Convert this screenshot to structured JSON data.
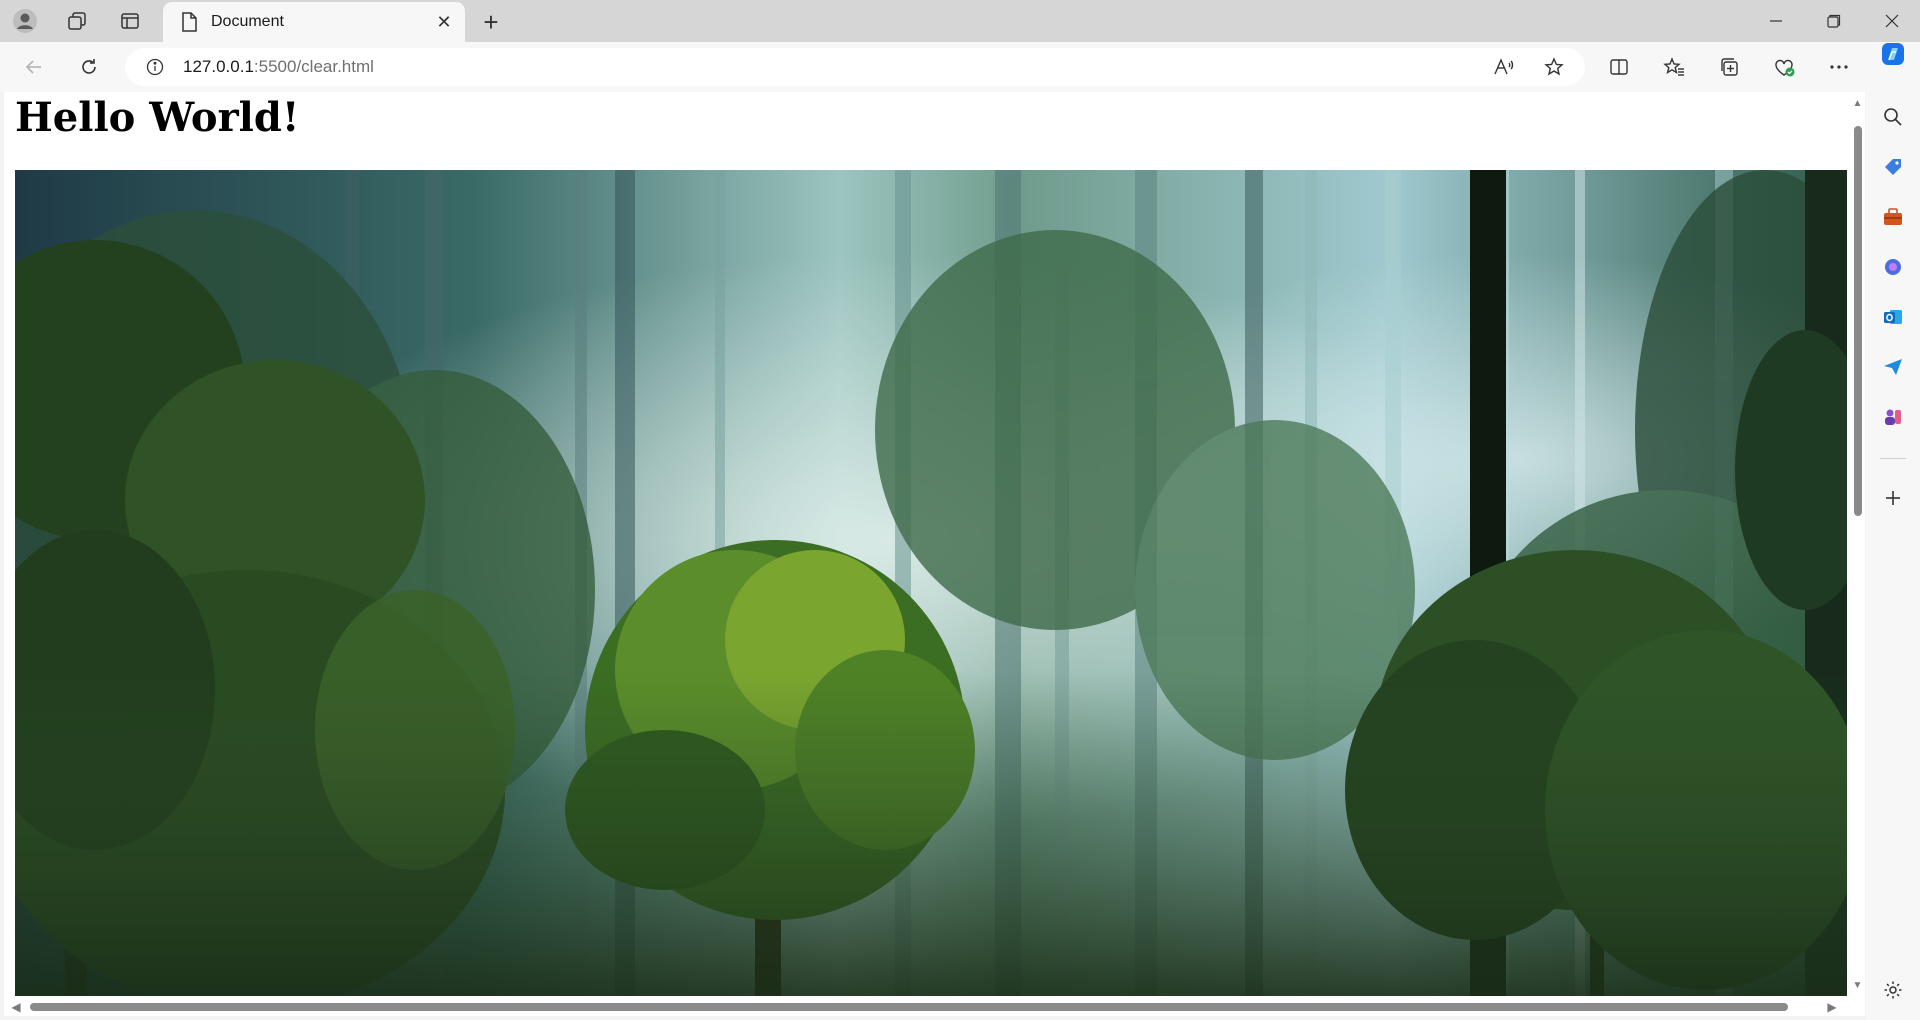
{
  "browser": {
    "tab": {
      "title": "Document"
    },
    "address": {
      "host": "127.0.0.1",
      "rest": ":5500/clear.html"
    }
  },
  "page": {
    "heading": "Hello World!",
    "image": {
      "subject": "forest",
      "colors": {
        "sky": "#bcd9d6",
        "mist": "#8fb9b4",
        "foliage": "#2f5a2a",
        "dark": "#0e1e14",
        "bright": "#6e9a2e"
      }
    }
  },
  "sidebar": {
    "icons": [
      "search-icon",
      "tag-icon",
      "toolbox-icon",
      "copilot-circle-icon",
      "outlook-icon",
      "send-icon",
      "games-icon",
      "add-icon",
      "settings-icon"
    ]
  },
  "colors": {
    "titlebar": "#d6d6d6",
    "toolbar": "#f7f7f7",
    "accent": "#1a73e8"
  }
}
